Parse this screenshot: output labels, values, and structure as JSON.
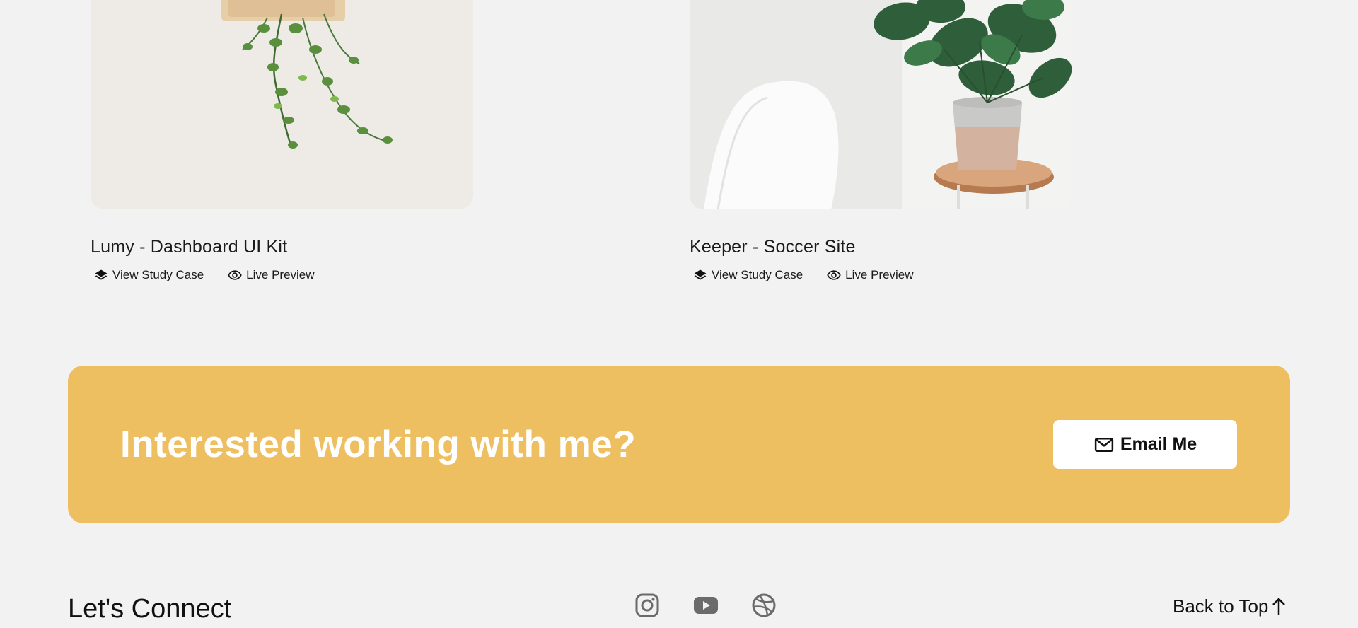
{
  "projects": [
    {
      "title": "Lumy - Dashboard UI Kit",
      "study_label": "View Study Case",
      "preview_label": "Live Preview"
    },
    {
      "title": "Keeper - Soccer Site",
      "study_label": "View Study Case",
      "preview_label": "Live Preview"
    }
  ],
  "cta": {
    "heading": "Interested working with me?",
    "button_label": "Email Me",
    "background": "#eebf61"
  },
  "footer": {
    "title": "Let's Connect",
    "social": [
      "instagram-icon",
      "youtube-icon",
      "dribbble-icon"
    ],
    "back_to_top": "Back to Top"
  }
}
